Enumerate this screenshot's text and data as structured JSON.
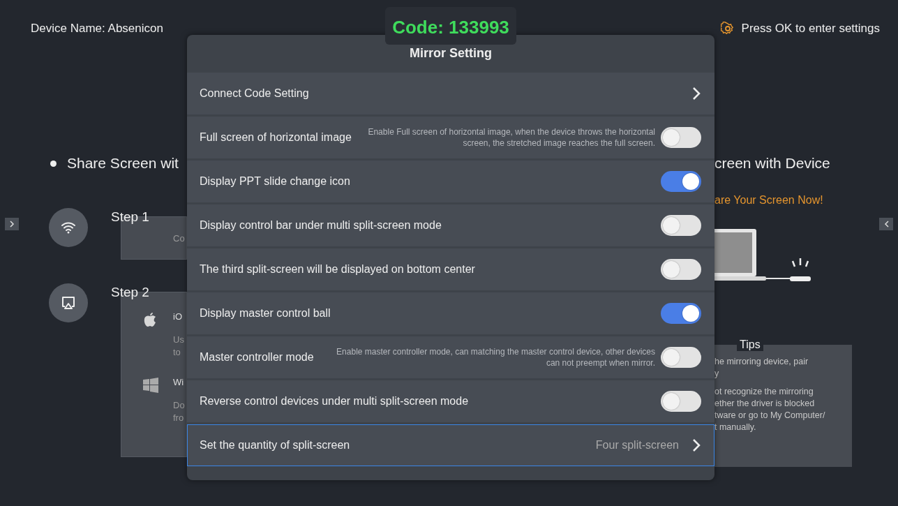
{
  "header": {
    "device_name": "Device Name: Absenicon",
    "code": "Code: 133993",
    "settings_hint": "Press OK to enter settings"
  },
  "left_panel": {
    "heading": "Share Screen wit",
    "steps": [
      {
        "label": "Step  1",
        "kind": "wifi",
        "lines": [
          "Co"
        ]
      },
      {
        "label": "Step  2",
        "kind": "cast",
        "groups": [
          {
            "kind": "apple",
            "lines": [
              "iO",
              "Us",
              "to"
            ]
          },
          {
            "kind": "windows",
            "lines": [
              "Wi",
              "Do",
              "fro"
            ]
          }
        ]
      }
    ]
  },
  "right_panel": {
    "heading": "creen with Device",
    "subheading": "are Your Screen Now!",
    "tips_title": "Tips",
    "tips": [
      "he mirroring device, pair",
      "y",
      "ot recognize the mirroring",
      "ether the driver is blocked",
      "tware or go to My Computer/",
      "t manually."
    ]
  },
  "dialog": {
    "title": "Mirror Setting",
    "rows": [
      {
        "kind": "nav",
        "label": "Connect Code Setting",
        "selected": false
      },
      {
        "kind": "toggle",
        "label": "Full screen of horizontal image",
        "description": "Enable Full screen of horizontal image, when the device throws the horizontal screen, the stretched image reaches the full screen.",
        "on": false,
        "selected": false
      },
      {
        "kind": "toggle",
        "label": "Display PPT slide change icon",
        "on": true,
        "selected": false
      },
      {
        "kind": "toggle",
        "label": "Display control bar under multi split-screen mode",
        "on": false,
        "selected": false
      },
      {
        "kind": "toggle",
        "label": "The third split-screen will be displayed on bottom center",
        "on": false,
        "selected": false
      },
      {
        "kind": "toggle",
        "label": "Display master control ball",
        "on": true,
        "selected": false
      },
      {
        "kind": "toggle",
        "label": "Master controller mode",
        "description": "Enable master controller mode, can matching the master control device, other devices can not preempt when mirror.",
        "on": false,
        "selected": false
      },
      {
        "kind": "toggle",
        "label": "Reverse control devices under multi split-screen mode",
        "on": false,
        "selected": false
      },
      {
        "kind": "nav",
        "label": "Set the quantity of split-screen",
        "value": "Four split-screen",
        "selected": true
      }
    ]
  }
}
